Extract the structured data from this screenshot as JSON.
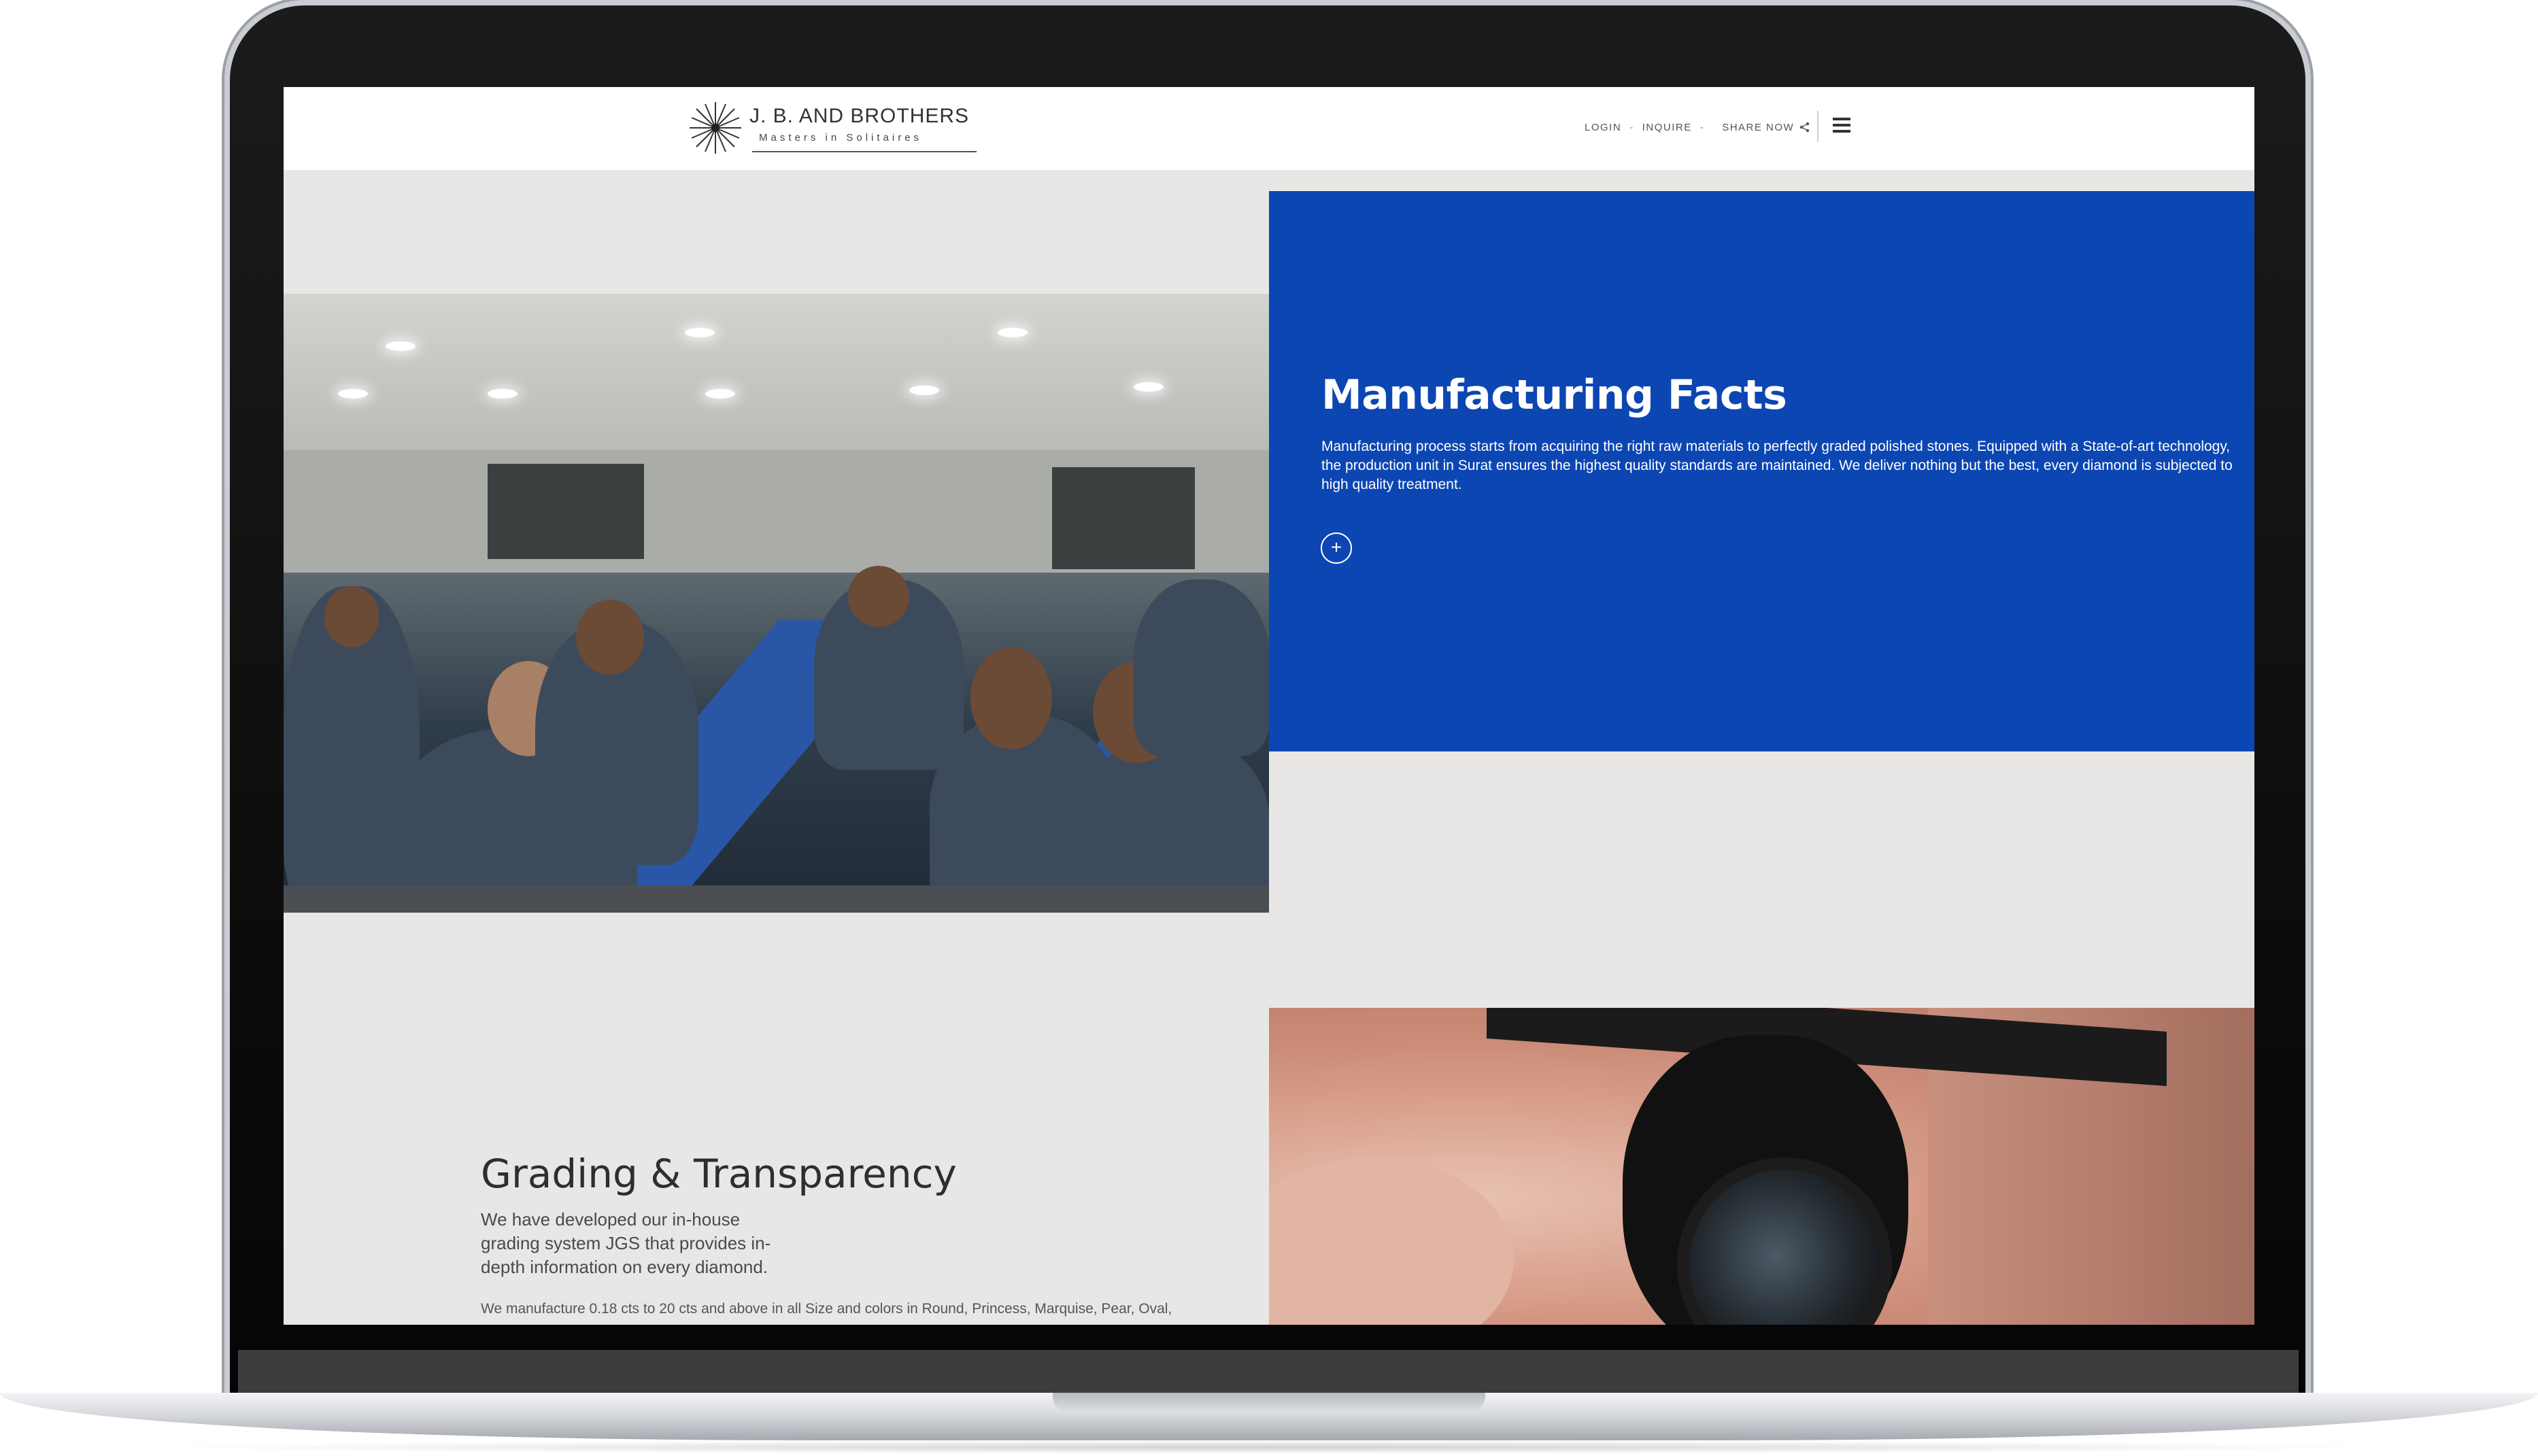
{
  "header": {
    "logo_title": "J. B. AND BROTHERS",
    "logo_subtitle": "Masters in Solitaires",
    "nav": {
      "login": "LOGIN",
      "inquire": "INQUIRE",
      "share": "SHARE NOW",
      "separator": "-"
    }
  },
  "facts": {
    "title": "Manufacturing Facts",
    "body": "Manufacturing process starts from acquiring the right raw materials to perfectly graded polished stones. Equipped with a State-of-art technology, the production unit in Surat ensures the highest quality standards are maintained. We deliver nothing but the best, every diamond is subjected to high quality treatment.",
    "more_button": "+",
    "panel_color": "#0c46b3"
  },
  "grading": {
    "title": "Grading & Transparency",
    "body": "We have developed our in-house grading system JGS that provides in-depth information on every diamond.",
    "note": "We manufacture 0.18 cts to 20 cts and above in all Size and colors in Round, Princess, Marquise, Pear, Oval,"
  },
  "icons": [
    "star-logo-icon",
    "share-icon",
    "hamburger-menu-icon",
    "plus-icon"
  ]
}
